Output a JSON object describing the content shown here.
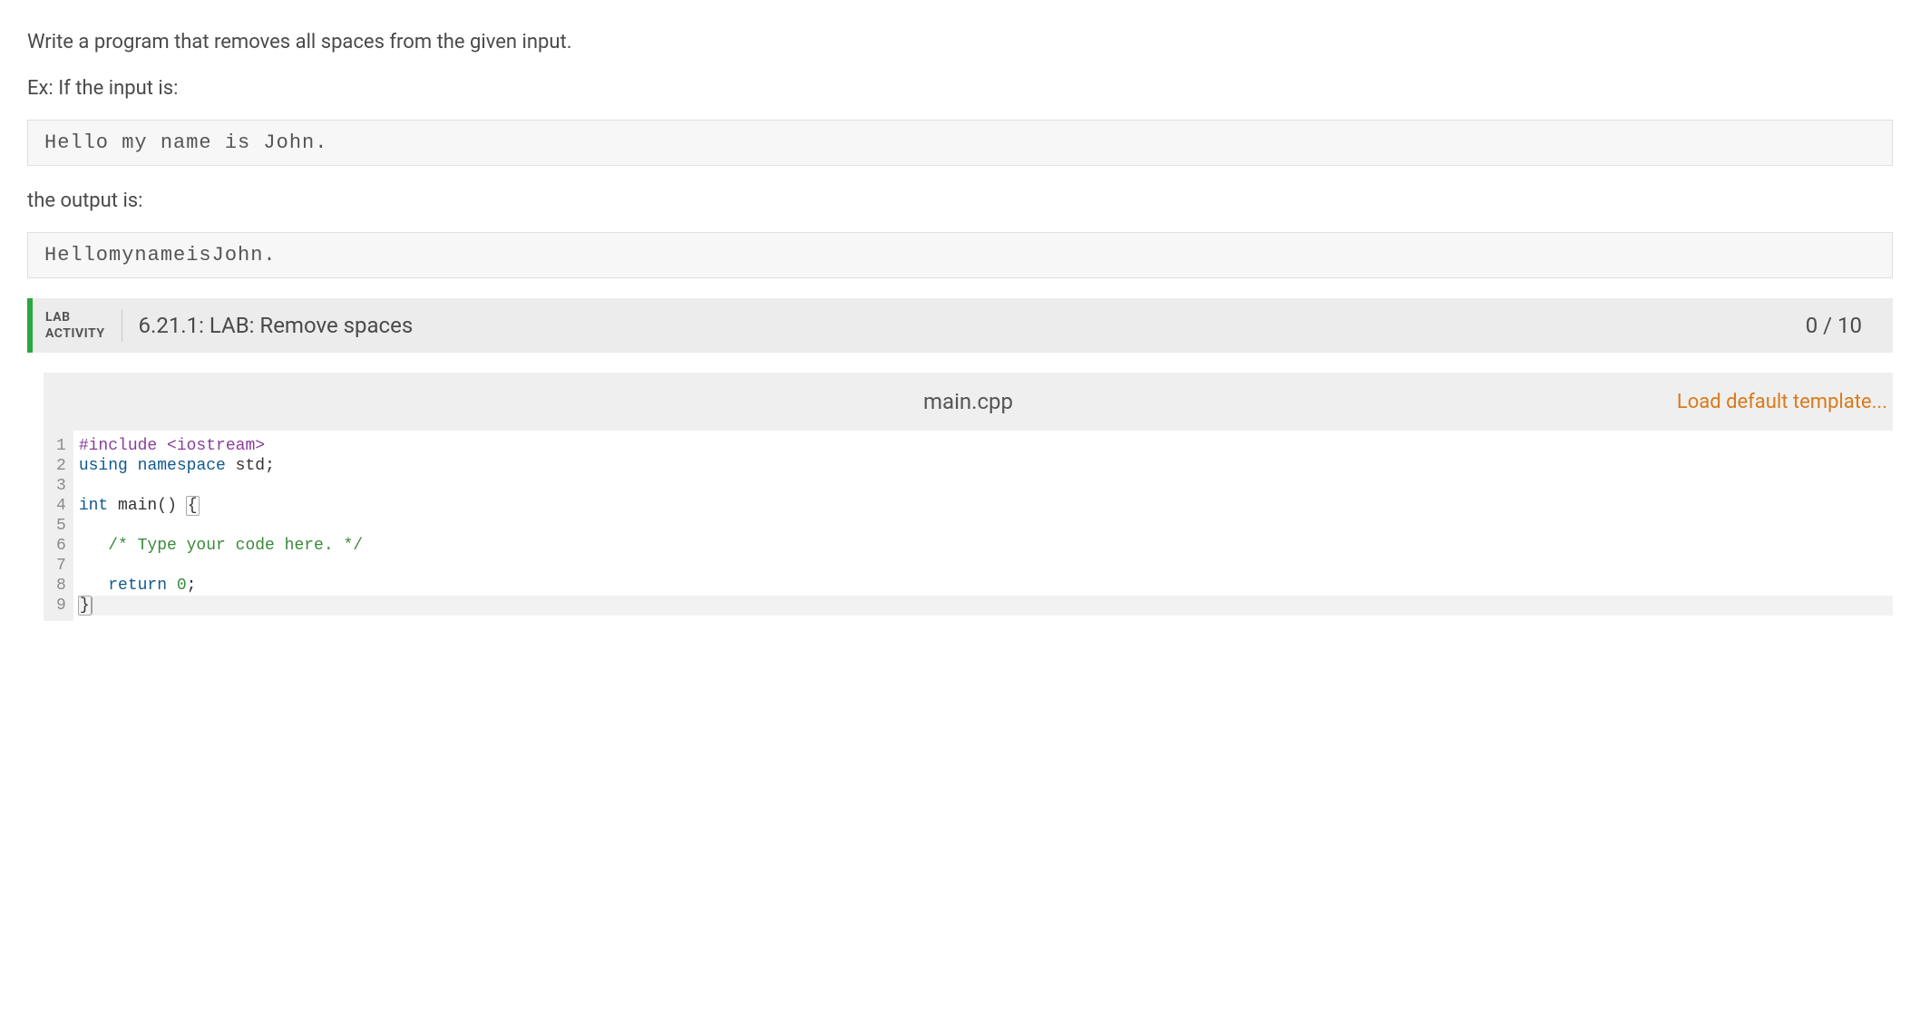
{
  "prompt": {
    "intro": "Write a program that removes all spaces from the given input.",
    "example_label": "Ex: If the input is:",
    "example_input": "Hello my name is John.",
    "output_label": "the output is:",
    "example_output": "HellomynameisJohn."
  },
  "lab": {
    "badge_line1": "LAB",
    "badge_line2": "ACTIVITY",
    "title": "6.21.1: LAB: Remove spaces",
    "score": "0 / 10"
  },
  "editor": {
    "filename": "main.cpp",
    "load_template_label": "Load default template...",
    "lines": [
      "#include <iostream>",
      "using namespace std;",
      "",
      "int main() {",
      "",
      "   /* Type your code here. */",
      "",
      "   return 0;",
      "}"
    ]
  }
}
